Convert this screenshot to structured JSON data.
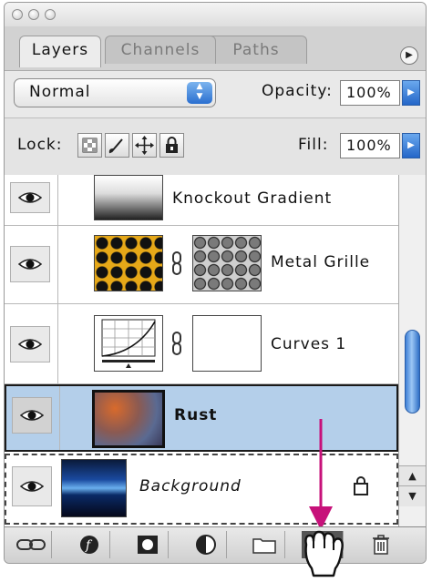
{
  "window": {
    "traffic_lights": [
      "close",
      "minimize",
      "zoom"
    ]
  },
  "tabs": [
    {
      "label": "Layers",
      "active": true
    },
    {
      "label": "Channels",
      "active": false
    },
    {
      "label": "Paths",
      "active": false
    }
  ],
  "blend": {
    "mode": "Normal"
  },
  "opacity": {
    "label": "Opacity:",
    "value": "100%"
  },
  "lock": {
    "label": "Lock:",
    "icons": [
      "lock-transparent-pixels-icon",
      "lock-image-pixels-icon",
      "lock-position-icon",
      "lock-all-icon"
    ]
  },
  "fill": {
    "label": "Fill:",
    "value": "100%"
  },
  "layers": [
    {
      "name": "Knockout Gradient",
      "visible": true,
      "selected": false
    },
    {
      "name": "Metal Grille",
      "visible": true,
      "selected": false
    },
    {
      "name": "Curves 1",
      "visible": true,
      "selected": false
    },
    {
      "name": "Rust",
      "visible": true,
      "selected": true
    },
    {
      "name": "Background",
      "visible": true,
      "selected": false,
      "locked": true
    }
  ],
  "bottom_buttons": [
    "link-layers-icon",
    "layer-style-icon",
    "add-mask-icon",
    "adjustment-layer-icon",
    "new-group-icon",
    "new-layer-icon",
    "trash-icon"
  ],
  "colors": {
    "selected_row": "#b4cfea",
    "accent_blue": "#2a6fd0",
    "drag_arrow": "#c7117a"
  }
}
